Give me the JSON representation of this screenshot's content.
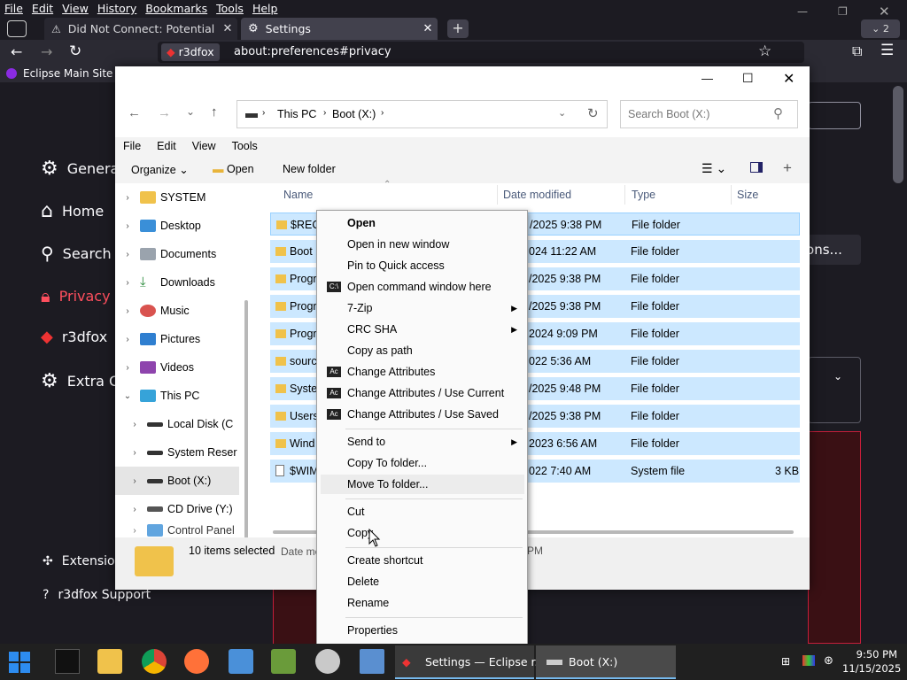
{
  "browser": {
    "menu": [
      "File",
      "Edit",
      "View",
      "History",
      "Bookmarks",
      "Tools",
      "Help"
    ],
    "tabs": [
      {
        "title": "Did Not Connect: Potential Secu"
      },
      {
        "title": "Settings"
      }
    ],
    "tab_count_badge": "2",
    "url_identity": "r3dfox",
    "url": "about:preferences#privacy",
    "bookmark": "Eclipse Main Site"
  },
  "settings_nav": {
    "items": [
      "General",
      "Home",
      "Search",
      "Privacy",
      "r3dfox",
      "Extra C"
    ],
    "footer": [
      "Extensions",
      "r3dfox Support"
    ],
    "options_btn": "tions..."
  },
  "explorer": {
    "breadcrumb": [
      "This PC",
      "Boot (X:)"
    ],
    "search_placeholder": "Search Boot (X:)",
    "menu": [
      "File",
      "Edit",
      "View",
      "Tools"
    ],
    "toolbar": {
      "organize": "Organize",
      "open": "Open",
      "new_folder": "New folder"
    },
    "columns": {
      "name": "Name",
      "date": "Date modified",
      "type": "Type",
      "size": "Size"
    },
    "tree": [
      {
        "label": "SYSTEM"
      },
      {
        "label": "Desktop"
      },
      {
        "label": "Documents"
      },
      {
        "label": "Downloads"
      },
      {
        "label": "Music"
      },
      {
        "label": "Pictures"
      },
      {
        "label": "Videos"
      },
      {
        "label": "This PC"
      },
      {
        "label": "Local Disk (C"
      },
      {
        "label": "System Reser"
      },
      {
        "label": "Boot (X:)"
      },
      {
        "label": "CD Drive (Y:)"
      },
      {
        "label": "Control Panel"
      }
    ],
    "files": [
      {
        "name": "$REC",
        "date": "/2025 9:38 PM",
        "type": "File folder",
        "size": ""
      },
      {
        "name": "Boot",
        "date": "024 11:22 AM",
        "type": "File folder",
        "size": ""
      },
      {
        "name": "Progr",
        "date": "/2025 9:38 PM",
        "type": "File folder",
        "size": ""
      },
      {
        "name": "Progr",
        "date": "/2025 9:38 PM",
        "type": "File folder",
        "size": ""
      },
      {
        "name": "Progr",
        "date": "2024 9:09 PM",
        "type": "File folder",
        "size": ""
      },
      {
        "name": "sourc",
        "date": "022 5:36 AM",
        "type": "File folder",
        "size": ""
      },
      {
        "name": "Syste",
        "date": "/2025 9:48 PM",
        "type": "File folder",
        "size": ""
      },
      {
        "name": "Users",
        "date": "/2025 9:38 PM",
        "type": "File folder",
        "size": ""
      },
      {
        "name": "Wind",
        "date": "2023 6:56 AM",
        "type": "File folder",
        "size": ""
      },
      {
        "name": "$WIM",
        "date": "022 7:40 AM",
        "type": "System file",
        "size": "3 KB"
      }
    ],
    "status": "10 items selected",
    "status_detail": "Date me",
    "status_detail2": "PM"
  },
  "context_menu": {
    "items": [
      {
        "label": "Open",
        "bold": true
      },
      {
        "label": "Open in new window"
      },
      {
        "label": "Pin to Quick access"
      },
      {
        "label": "Open command window here",
        "icon": "cmd"
      },
      {
        "label": "7-Zip",
        "submenu": true
      },
      {
        "label": "CRC SHA",
        "submenu": true
      },
      {
        "label": "Copy as path"
      },
      {
        "label": "Change Attributes",
        "icon": "Ac"
      },
      {
        "label": "Change Attributes / Use Current",
        "icon": "Ac"
      },
      {
        "label": "Change Attributes / Use Saved",
        "icon": "Ac"
      },
      {
        "label": "Send to",
        "submenu": true
      },
      {
        "label": "Copy To folder..."
      },
      {
        "label": "Move To folder...",
        "hover": true
      },
      {
        "label": "Cut"
      },
      {
        "label": "Copy"
      },
      {
        "label": "Create shortcut"
      },
      {
        "label": "Delete"
      },
      {
        "label": "Rename"
      },
      {
        "label": "Properties"
      }
    ]
  },
  "taskbar": {
    "windows": [
      {
        "label": "Settings — Eclipse r..."
      },
      {
        "label": "Boot (X:)"
      }
    ],
    "time": "9:50 PM",
    "date": "11/15/2025"
  }
}
